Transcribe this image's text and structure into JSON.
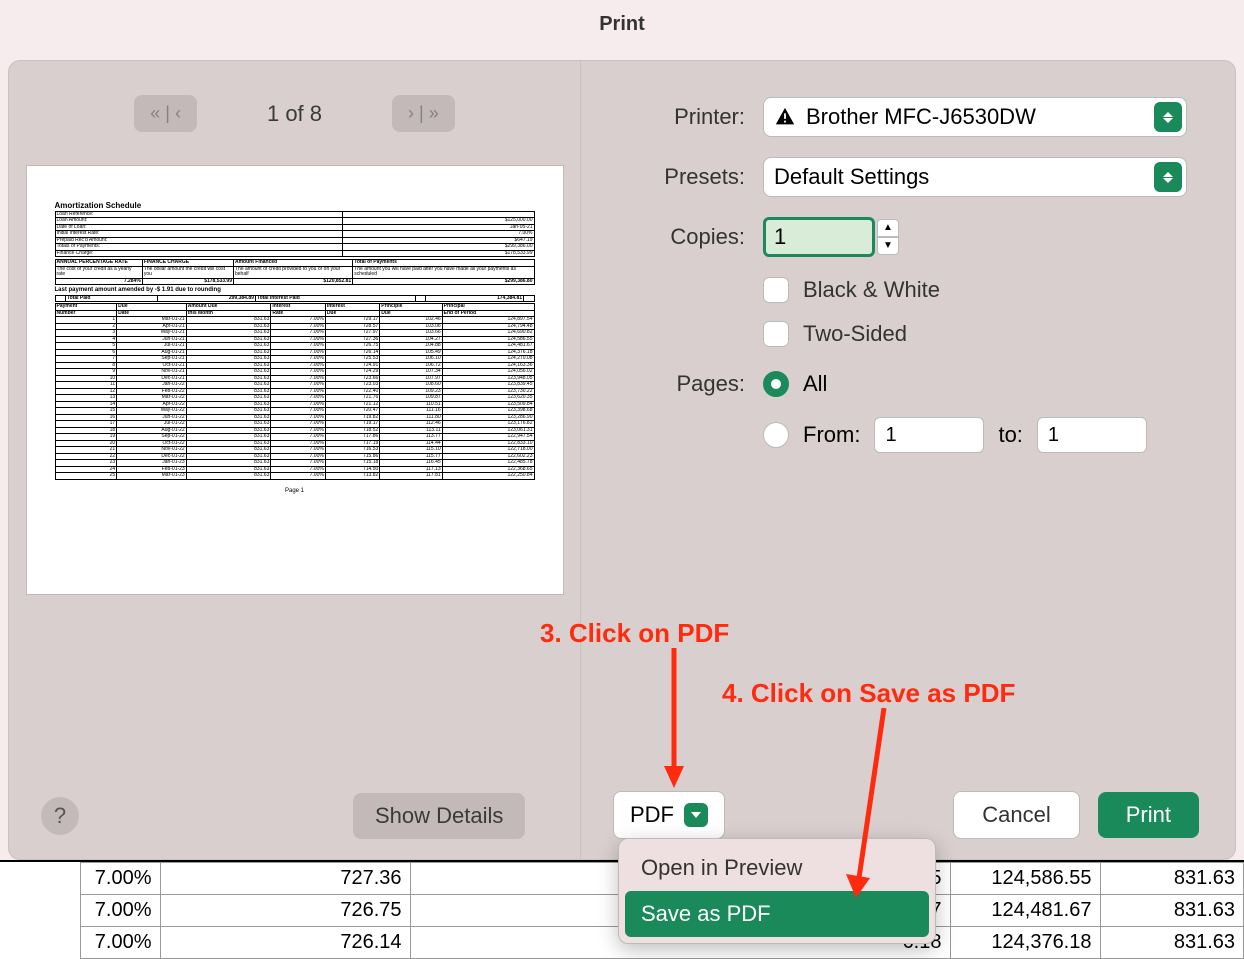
{
  "title": "Print",
  "nav": {
    "page_of": "1 of 8"
  },
  "preview": {
    "heading": "Amortization Schedule",
    "meta": [
      [
        "Loan Reference:",
        ""
      ],
      [
        "Loan Amount:",
        "$125,000.00"
      ],
      [
        "Date of Loan:",
        "Jan-05-21"
      ],
      [
        "Initial Interest Rate:",
        "7.00%"
      ],
      [
        "Prepaid Rec'd Amount:",
        "$647.19"
      ],
      [
        "Totals of Payments:",
        "$299,386.00"
      ],
      [
        "Finance Charge:",
        "$178,533.99"
      ]
    ],
    "disclosure": {
      "apr": {
        "h": "ANNUAL PERCENTAGE RATE",
        "d": "The cost of your credit as a yearly rate",
        "v": "7.284%"
      },
      "fin": {
        "h": "FINANCE CHARGE",
        "d": "The dollar amount the credit will cost you",
        "v": "$178,533.99"
      },
      "amt": {
        "h": "Amount Financed",
        "d": "The amount of credit provided to you or on your behalf",
        "v": "$120,852.81"
      },
      "tot": {
        "h": "Total of Payments",
        "d": "The amount you will have paid after you have made all your payments as scheduled",
        "v": "$299,386.80"
      }
    },
    "amend": "Last payment amount amended by -$ 1.91 due to rounding",
    "totals": {
      "paid": "299,384.89",
      "interest": "174,384.81"
    },
    "cols": [
      "Payment Number",
      "Due Date",
      "Amount Due this Month",
      "Interest Rate",
      "Interest Due",
      "Principle Due",
      "Principal End of Period"
    ],
    "rows": [
      [
        "1",
        "Mar-01-21",
        "831.63",
        "7.00%",
        "729.17",
        "102.46",
        "124,897.54"
      ],
      [
        "2",
        "Apr-01-21",
        "831.63",
        "7.00%",
        "728.57",
        "103.06",
        "124,794.48"
      ],
      [
        "3",
        "May-01-21",
        "831.63",
        "7.00%",
        "727.97",
        "103.66",
        "124,690.82"
      ],
      [
        "4",
        "Jun-01-21",
        "831.63",
        "7.00%",
        "727.36",
        "104.27",
        "124,586.55"
      ],
      [
        "5",
        "Jul-01-21",
        "831.63",
        "7.00%",
        "726.75",
        "104.88",
        "124,481.67"
      ],
      [
        "6",
        "Aug-01-21",
        "831.63",
        "7.00%",
        "726.14",
        "105.49",
        "124,376.18"
      ],
      [
        "7",
        "Sep-01-21",
        "831.63",
        "7.00%",
        "725.53",
        "106.10",
        "124,270.08"
      ],
      [
        "8",
        "Oct-01-21",
        "831.63",
        "7.00%",
        "724.91",
        "106.72",
        "124,163.36"
      ],
      [
        "9",
        "Nov-01-21",
        "831.63",
        "7.00%",
        "724.29",
        "107.34",
        "124,056.02"
      ],
      [
        "10",
        "Dec-01-21",
        "831.63",
        "7.00%",
        "723.66",
        "107.97",
        "123,948.05"
      ],
      [
        "11",
        "Jan-01-22",
        "831.63",
        "7.00%",
        "723.03",
        "108.60",
        "123,839.45"
      ],
      [
        "12",
        "Feb-01-22",
        "831.63",
        "7.00%",
        "722.40",
        "109.23",
        "123,730.22"
      ],
      [
        "13",
        "Mar-01-22",
        "831.63",
        "7.00%",
        "721.76",
        "109.87",
        "123,620.35"
      ],
      [
        "14",
        "Apr-01-22",
        "831.63",
        "7.00%",
        "721.12",
        "110.51",
        "123,509.84"
      ],
      [
        "15",
        "May-01-22",
        "831.63",
        "7.00%",
        "720.47",
        "111.16",
        "123,398.68"
      ],
      [
        "16",
        "Jun-01-22",
        "831.63",
        "7.00%",
        "719.82",
        "111.80",
        "123,286.90"
      ],
      [
        "17",
        "Jul-01-22",
        "831.63",
        "7.00%",
        "719.17",
        "112.46",
        "123,176.82"
      ],
      [
        "18",
        "Aug-01-22",
        "831.63",
        "7.00%",
        "718.52",
        "113.11",
        "123,061.31"
      ],
      [
        "19",
        "Sep-01-22",
        "831.63",
        "7.00%",
        "717.86",
        "113.77",
        "122,947.54"
      ],
      [
        "20",
        "Oct-01-22",
        "831.63",
        "7.00%",
        "717.19",
        "114.44",
        "122,833.10"
      ],
      [
        "21",
        "Nov-01-22",
        "831.63",
        "7.00%",
        "716.53",
        "115.10",
        "122,718.00"
      ],
      [
        "22",
        "Dec-01-22",
        "831.63",
        "7.00%",
        "715.86",
        "115.77",
        "122,602.23"
      ],
      [
        "23",
        "Jan-01-23",
        "831.63",
        "7.00%",
        "715.18",
        "116.45",
        "122,485.78"
      ],
      [
        "24",
        "Feb-01-23",
        "831.63",
        "7.00%",
        "714.50",
        "117.13",
        "122,368.65"
      ],
      [
        "25",
        "Mar-01-23",
        "831.63",
        "7.00%",
        "713.82",
        "117.81",
        "122,250.84"
      ]
    ],
    "page": "Page 1"
  },
  "form": {
    "printer_label": "Printer:",
    "printer_value": "Brother MFC-J6530DW",
    "presets_label": "Presets:",
    "presets_value": "Default Settings",
    "copies_label": "Copies:",
    "copies_value": "1",
    "bw_label": "Black & White",
    "twosided_label": "Two-Sided",
    "pages_label": "Pages:",
    "all_label": "All",
    "from_label": "From:",
    "to_label": "to:",
    "from_value": "1",
    "to_value": "1"
  },
  "buttons": {
    "help": "?",
    "show_details": "Show Details",
    "pdf": "PDF",
    "cancel": "Cancel",
    "print": "Print"
  },
  "pdf_menu": {
    "open_preview": "Open in Preview",
    "save_as_pdf": "Save as PDF"
  },
  "annotations": {
    "a3": "3. Click on PDF",
    "a4": "4. Click on Save as PDF"
  },
  "bg_rows": [
    [
      "7.00%",
      "727.36",
      "6.55",
      "124,586.55",
      "831.63"
    ],
    [
      "7.00%",
      "726.75",
      "1.67",
      "124,481.67",
      "831.63"
    ],
    [
      "7.00%",
      "726.14",
      "6.18",
      "124,376.18",
      "831.63"
    ]
  ]
}
